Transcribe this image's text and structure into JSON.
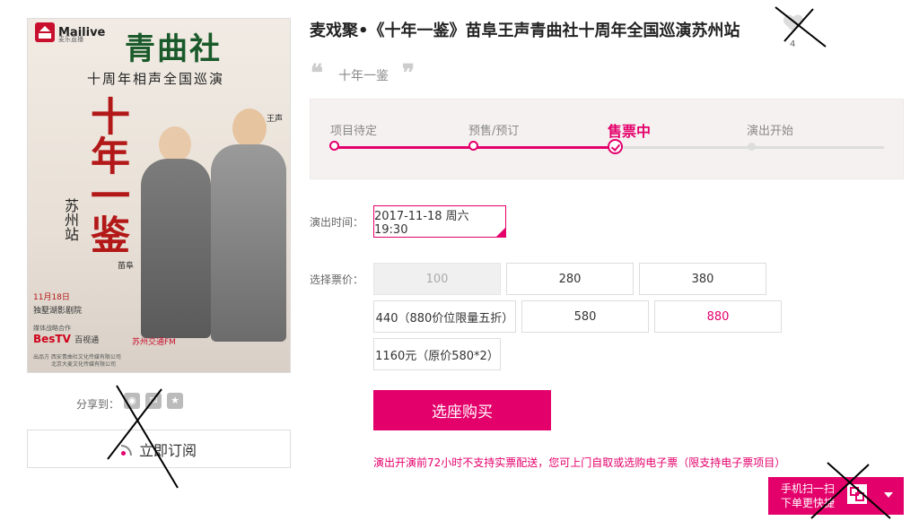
{
  "poster": {
    "logo_text": "Mailive",
    "logo_sub": "麦乐直播",
    "title_big": "青曲社",
    "subtitle": "十周年相声全国巡演",
    "calligraphy": "十年一鉴",
    "city": "苏州站",
    "date": "11月18日",
    "venue": "独墅湖影剧院",
    "sponsor": "媒体战略合作",
    "bestv": "BesTV",
    "bestv_sub": "百视通",
    "fm": "苏州交通FM",
    "orgs_1": "出品方 西安青曲社文化传媒有限公司",
    "orgs_2": "北京大麦文化传媒有限公司",
    "signature": "苗阜",
    "signature2": "王声"
  },
  "share": {
    "label": "分享到：",
    "icons": [
      "weibo-icon",
      "wechat-icon",
      "qzone-icon"
    ]
  },
  "subscribe_label": "立即订阅",
  "event": {
    "title": "麦戏聚•《十年一鉴》苗阜王声青曲社十周年全国巡演苏州站",
    "fav_count": "4",
    "tagline": "十年一鉴"
  },
  "progress": {
    "stages": [
      {
        "label": "项目待定",
        "state": "done"
      },
      {
        "label": "预售/预订",
        "state": "done"
      },
      {
        "label": "售票中",
        "state": "active"
      },
      {
        "label": "演出开始",
        "state": "pending"
      }
    ]
  },
  "time": {
    "label": "演出时间：",
    "value": "2017-11-18 周六 19:30"
  },
  "prices": {
    "label": "选择票价：",
    "options": [
      {
        "label": "100",
        "state": "disabled"
      },
      {
        "label": "280",
        "state": "normal"
      },
      {
        "label": "380",
        "state": "normal"
      },
      {
        "label": "440（880价位限量五折）",
        "state": "normal"
      },
      {
        "label": "580",
        "state": "normal"
      },
      {
        "label": "880",
        "state": "highlight"
      },
      {
        "label": "1160元（原价580*2）",
        "state": "normal"
      }
    ]
  },
  "buy_button": "选座购买",
  "notice": "演出开演前72小时不支持实票配送，您可上门自取或选购电子票（限支持电子票项目）",
  "qr_bar": {
    "line1": "手机扫一扫",
    "line2": "下单更快捷"
  },
  "colors": {
    "accent": "#e4006b",
    "muted": "#888888",
    "panel": "#f6f1f1"
  }
}
